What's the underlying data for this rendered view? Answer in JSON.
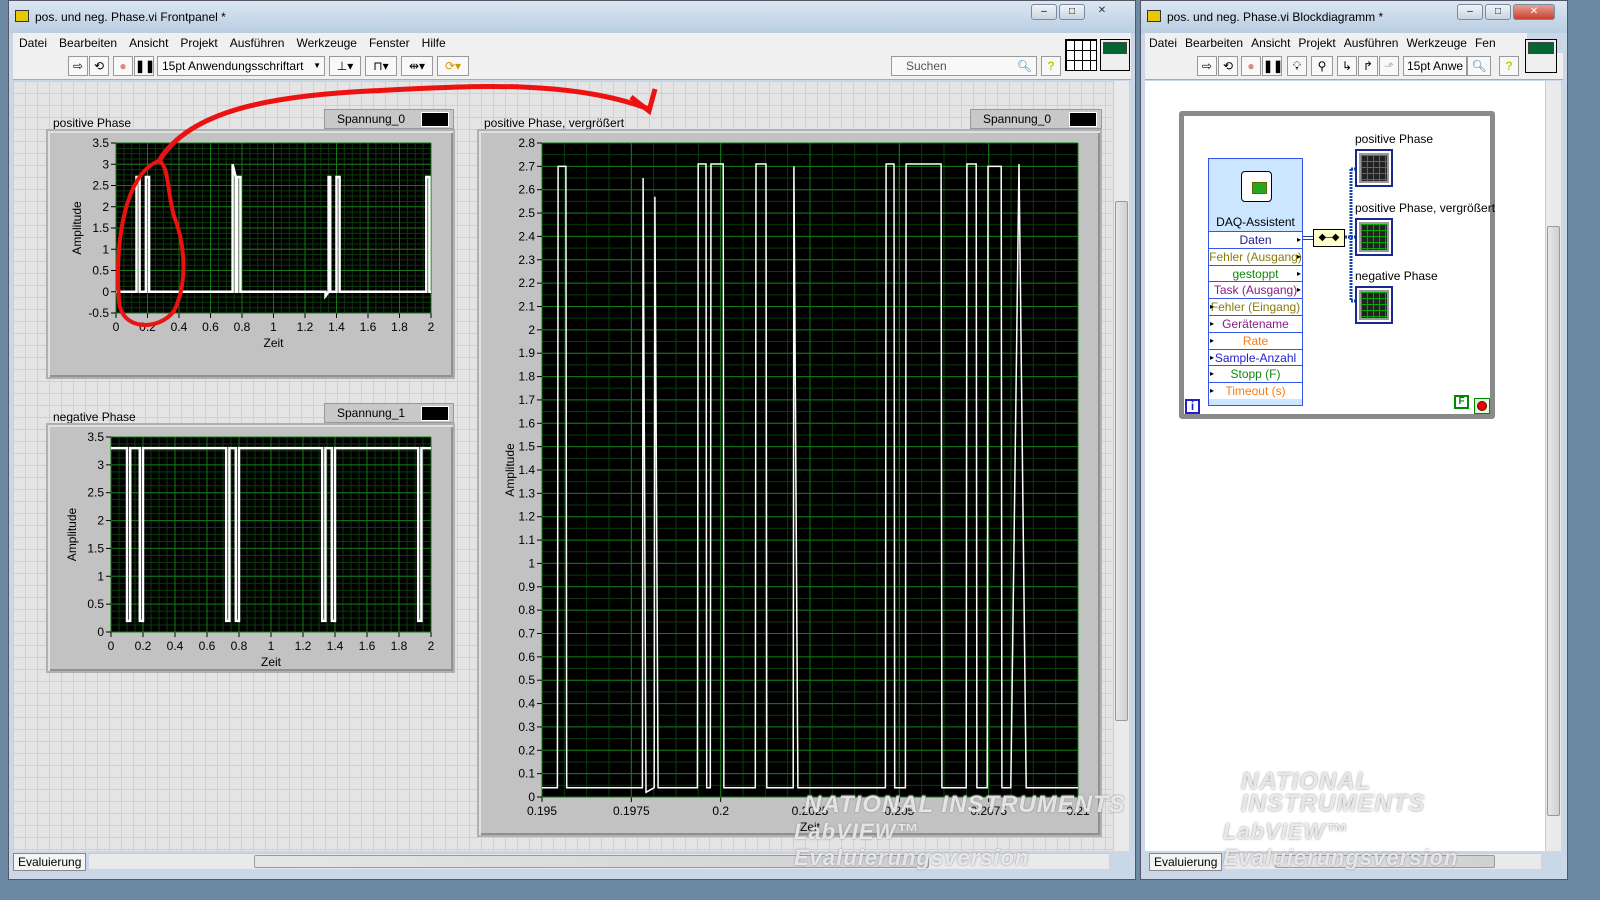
{
  "front_panel": {
    "title": "pos. und neg. Phase.vi Frontpanel *",
    "menu": [
      "Datei",
      "Bearbeiten",
      "Ansicht",
      "Projekt",
      "Ausführen",
      "Werkzeuge",
      "Fenster",
      "Hilfe"
    ],
    "font_select": "15pt Anwendungsschriftart",
    "search_placeholder": "Suchen",
    "help": "?",
    "status": "Evaluierung",
    "graphs": {
      "pos": {
        "label": "positive Phase",
        "legend": "Spannung_0"
      },
      "neg": {
        "label": "negative Phase",
        "legend": "Spannung_1"
      },
      "zoom": {
        "label": "positive Phase, vergrößert",
        "legend": "Spannung_0"
      }
    }
  },
  "block_diagram": {
    "title": "pos. und neg. Phase.vi Blockdiagramm *",
    "menu": [
      "Datei",
      "Bearbeiten",
      "Ansicht",
      "Projekt",
      "Ausführen",
      "Werkzeuge",
      "Fen"
    ],
    "font_select": "15pt Anwe",
    "help": "?",
    "status": "Evaluierung",
    "daq": {
      "title": "DAQ-Assistent",
      "terminals": [
        {
          "label": "Daten",
          "color": "#1a1a8a"
        },
        {
          "label": "Fehler (Ausgang)",
          "color": "#8a7a10"
        },
        {
          "label": "gestoppt",
          "color": "#118811"
        },
        {
          "label": "Task (Ausgang)",
          "color": "#8a1a8a"
        },
        {
          "label": "Fehler (Eingang)",
          "color": "#8a7a10"
        },
        {
          "label": "Gerätename",
          "color": "#8a1a8a"
        },
        {
          "label": "Rate",
          "color": "#ff7a10"
        },
        {
          "label": "Sample-Anzahl",
          "color": "#2222cc"
        },
        {
          "label": "Stopp (F)",
          "color": "#118811"
        },
        {
          "label": "Timeout (s)",
          "color": "#ff7a10"
        }
      ]
    },
    "indicators": [
      "positive Phase",
      "positive Phase, vergrößert",
      "negative Phase"
    ],
    "loop_iteration": "i",
    "stop_constant": "F"
  },
  "watermark": {
    "brand": "NATIONAL INSTRUMENTS",
    "product": "LabVIEW™ Evaluierungsversion"
  },
  "chart_data": [
    {
      "type": "line",
      "title": "positive Phase",
      "xlabel": "Zeit",
      "ylabel": "Amplitude",
      "xlim": [
        0,
        2
      ],
      "ylim": [
        -0.5,
        3.5
      ],
      "xticks": [
        0,
        0.2,
        0.4,
        0.6,
        0.8,
        1,
        1.2,
        1.4,
        1.6,
        1.8,
        2
      ],
      "yticks": [
        -0.5,
        0,
        0.5,
        1,
        1.5,
        2,
        2.5,
        3,
        3.5
      ],
      "series": [
        {
          "name": "Spannung_0",
          "points": [
            [
              0,
              0
            ],
            [
              0.13,
              0
            ],
            [
              0.13,
              2.7
            ],
            [
              0.15,
              2.7
            ],
            [
              0.15,
              0
            ],
            [
              0.19,
              0
            ],
            [
              0.19,
              2.7
            ],
            [
              0.21,
              2.7
            ],
            [
              0.21,
              0
            ],
            [
              0.74,
              0
            ],
            [
              0.74,
              3.0
            ],
            [
              0.76,
              2.7
            ],
            [
              0.76,
              0
            ],
            [
              0.77,
              0
            ],
            [
              0.77,
              2.7
            ],
            [
              0.79,
              2.7
            ],
            [
              0.79,
              0
            ],
            [
              1.33,
              0
            ],
            [
              1.33,
              -0.1
            ],
            [
              1.35,
              0
            ],
            [
              1.35,
              2.7
            ],
            [
              1.36,
              2.7
            ],
            [
              1.36,
              0
            ],
            [
              1.4,
              0
            ],
            [
              1.4,
              2.7
            ],
            [
              1.42,
              2.7
            ],
            [
              1.42,
              0
            ],
            [
              1.97,
              0
            ],
            [
              1.97,
              2.7
            ],
            [
              1.99,
              2.7
            ],
            [
              1.99,
              0
            ],
            [
              2,
              0
            ]
          ]
        }
      ]
    },
    {
      "type": "line",
      "title": "negative Phase",
      "xlabel": "Zeit",
      "ylabel": "Amplitude",
      "xlim": [
        0,
        2
      ],
      "ylim": [
        0,
        3.5
      ],
      "xticks": [
        0,
        0.2,
        0.4,
        0.6,
        0.8,
        1,
        1.2,
        1.4,
        1.6,
        1.8,
        2
      ],
      "yticks": [
        0,
        0.5,
        1,
        1.5,
        2,
        2.5,
        3,
        3.5
      ],
      "series": [
        {
          "name": "Spannung_1",
          "points": [
            [
              0,
              3.3
            ],
            [
              0.1,
              3.3
            ],
            [
              0.1,
              0.2
            ],
            [
              0.12,
              0.2
            ],
            [
              0.12,
              3.3
            ],
            [
              0.18,
              3.3
            ],
            [
              0.18,
              0.2
            ],
            [
              0.2,
              0.2
            ],
            [
              0.2,
              3.3
            ],
            [
              0.72,
              3.3
            ],
            [
              0.72,
              0.2
            ],
            [
              0.74,
              0.2
            ],
            [
              0.74,
              3.3
            ],
            [
              0.78,
              3.3
            ],
            [
              0.78,
              0.2
            ],
            [
              0.8,
              0.2
            ],
            [
              0.8,
              3.3
            ],
            [
              1.32,
              3.3
            ],
            [
              1.32,
              0.2
            ],
            [
              1.34,
              0.2
            ],
            [
              1.34,
              3.3
            ],
            [
              1.38,
              3.3
            ],
            [
              1.38,
              0.2
            ],
            [
              1.4,
              0.2
            ],
            [
              1.4,
              3.3
            ],
            [
              1.92,
              3.3
            ],
            [
              1.92,
              0.2
            ],
            [
              1.94,
              0.2
            ],
            [
              1.94,
              3.3
            ],
            [
              2,
              3.3
            ]
          ]
        }
      ]
    },
    {
      "type": "line",
      "title": "positive Phase, vergrößert",
      "xlabel": "Zeit",
      "ylabel": "Amplitude",
      "xlim": [
        0.195,
        0.21
      ],
      "ylim": [
        0,
        2.8
      ],
      "xticks": [
        0.195,
        0.1975,
        0.2,
        0.2025,
        0.205,
        0.2075,
        0.21
      ],
      "yticks": [
        0,
        0.1,
        0.2,
        0.3,
        0.4,
        0.5,
        0.6,
        0.7,
        0.8,
        0.9,
        1,
        1.1,
        1.2,
        1.3,
        1.4,
        1.5,
        1.6,
        1.7,
        1.8,
        1.9,
        2,
        2.1,
        2.2,
        2.3,
        2.4,
        2.5,
        2.6,
        2.7,
        2.8
      ],
      "series": [
        {
          "name": "Spannung_0",
          "points": [
            [
              0.195,
              0.04
            ],
            [
              0.19543,
              0.04
            ],
            [
              0.19545,
              2.7
            ],
            [
              0.19567,
              2.7
            ],
            [
              0.19569,
              0.04
            ],
            [
              0.19781,
              0.04
            ],
            [
              0.19783,
              2.65
            ],
            [
              0.19791,
              0.02
            ],
            [
              0.19814,
              0.04
            ],
            [
              0.19816,
              2.57
            ],
            [
              0.19825,
              0.04
            ],
            [
              0.19935,
              0.04
            ],
            [
              0.19937,
              2.71
            ],
            [
              0.19959,
              2.71
            ],
            [
              0.19961,
              0.04
            ],
            [
              0.19971,
              0.04
            ],
            [
              0.19973,
              2.71
            ],
            [
              0.20007,
              2.71
            ],
            [
              0.20009,
              0.04
            ],
            [
              0.20097,
              0.04
            ],
            [
              0.20099,
              2.71
            ],
            [
              0.20127,
              2.71
            ],
            [
              0.20129,
              0.04
            ],
            [
              0.20203,
              0.04
            ],
            [
              0.20205,
              2.7
            ],
            [
              0.20216,
              0.04
            ],
            [
              0.20461,
              0.04
            ],
            [
              0.20463,
              2.71
            ],
            [
              0.20485,
              2.71
            ],
            [
              0.20487,
              0.04
            ],
            [
              0.20517,
              0.04
            ],
            [
              0.20519,
              2.71
            ],
            [
              0.20617,
              2.71
            ],
            [
              0.20619,
              0.04
            ],
            [
              0.20687,
              0.04
            ],
            [
              0.20689,
              2.71
            ],
            [
              0.20715,
              2.71
            ],
            [
              0.20717,
              0.04
            ],
            [
              0.20746,
              0.04
            ],
            [
              0.20748,
              2.7
            ],
            [
              0.20785,
              2.7
            ],
            [
              0.20787,
              0.04
            ],
            [
              0.20812,
              0.04
            ],
            [
              0.20835,
              2.71
            ],
            [
              0.20855,
              0.04
            ],
            [
              0.21,
              0.04
            ]
          ]
        }
      ]
    }
  ]
}
